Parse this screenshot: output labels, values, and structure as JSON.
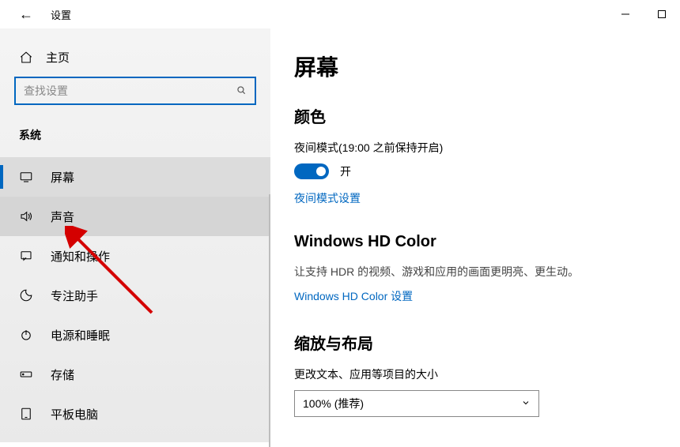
{
  "titlebar": {
    "back": "←",
    "title": "设置"
  },
  "sidebar": {
    "home": "主页",
    "search_placeholder": "查找设置",
    "section": "系统",
    "items": [
      {
        "label": "屏幕"
      },
      {
        "label": "声音"
      },
      {
        "label": "通知和操作"
      },
      {
        "label": "专注助手"
      },
      {
        "label": "电源和睡眠"
      },
      {
        "label": "存储"
      },
      {
        "label": "平板电脑"
      }
    ]
  },
  "content": {
    "page_title": "屏幕",
    "color": {
      "heading": "颜色",
      "night_label": "夜间模式(19:00 之前保持开启)",
      "toggle_state": "开",
      "settings_link": "夜间模式设置"
    },
    "hd": {
      "heading": "Windows HD Color",
      "desc": "让支持 HDR 的视频、游戏和应用的画面更明亮、更生动。",
      "link": "Windows HD Color 设置"
    },
    "scale": {
      "heading": "缩放与布局",
      "label": "更改文本、应用等项目的大小",
      "value": "100% (推荐)"
    }
  }
}
